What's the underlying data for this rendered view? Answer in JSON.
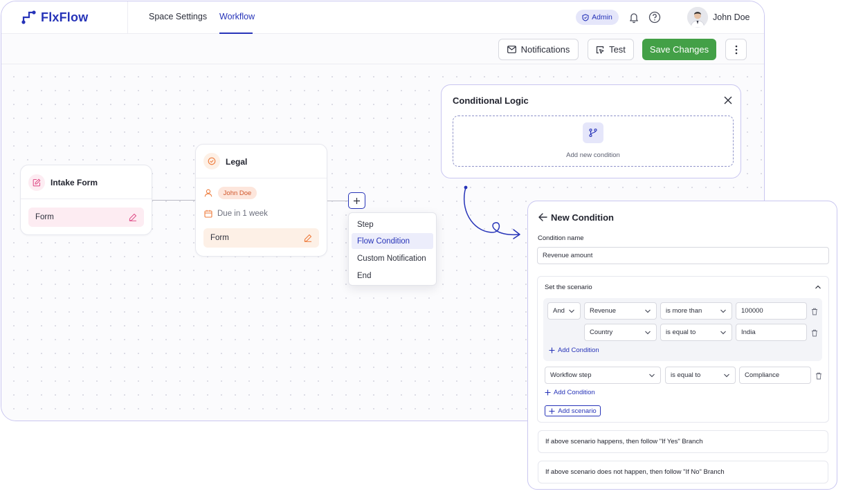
{
  "brand": {
    "name": "FlxFlow",
    "color": "#2633b8"
  },
  "nav": {
    "tabs": [
      {
        "label": "Space Settings"
      },
      {
        "label": "Workflow",
        "active": true
      }
    ]
  },
  "header": {
    "role_badge": "Admin",
    "user_name": "John Doe"
  },
  "toolbar": {
    "notifications_label": "Notifications",
    "test_label": "Test",
    "save_label": "Save Changes"
  },
  "nodes": {
    "intake": {
      "title": "Intake Form",
      "form_label": "Form"
    },
    "legal": {
      "title": "Legal",
      "assignee": "John Doe",
      "due": "Due in 1 week",
      "form_label": "Form"
    }
  },
  "add_menu": {
    "items": [
      "Step",
      "Flow Condition",
      "Custom Notification",
      "End"
    ],
    "active_index": 1
  },
  "conditional_logic": {
    "title": "Conditional Logic",
    "add_text": "Add new condition"
  },
  "new_condition": {
    "title": "New Condition",
    "name_label": "Condition name",
    "name_value": "Revenue amount",
    "scenario_title": "Set the scenario",
    "group": {
      "operator": "And",
      "rows": [
        {
          "field": "Revenue",
          "comparator": "is more than",
          "value": "100000"
        },
        {
          "field": "Country",
          "comparator": "is equal to",
          "value": "India"
        }
      ],
      "add_label": "Add Condition"
    },
    "row": {
      "field": "Workflow step",
      "comparator": "is equal to",
      "value": "Compliance"
    },
    "add_condition_label": "Add Condition",
    "add_scenario_label": "Add scenario",
    "yes_branch": "If above scenario happens, then follow \"If Yes\" Branch",
    "no_branch": "If above scenario does not happen, then follow \"If No\" Branch"
  },
  "colors": {
    "accent": "#2633b8",
    "save": "#43a047",
    "panel_border": "#c9c6f0",
    "intake_pill": "#fdecf2",
    "legal_pill": "#fdf0e6",
    "assignee_badge": "#fde6dc"
  }
}
